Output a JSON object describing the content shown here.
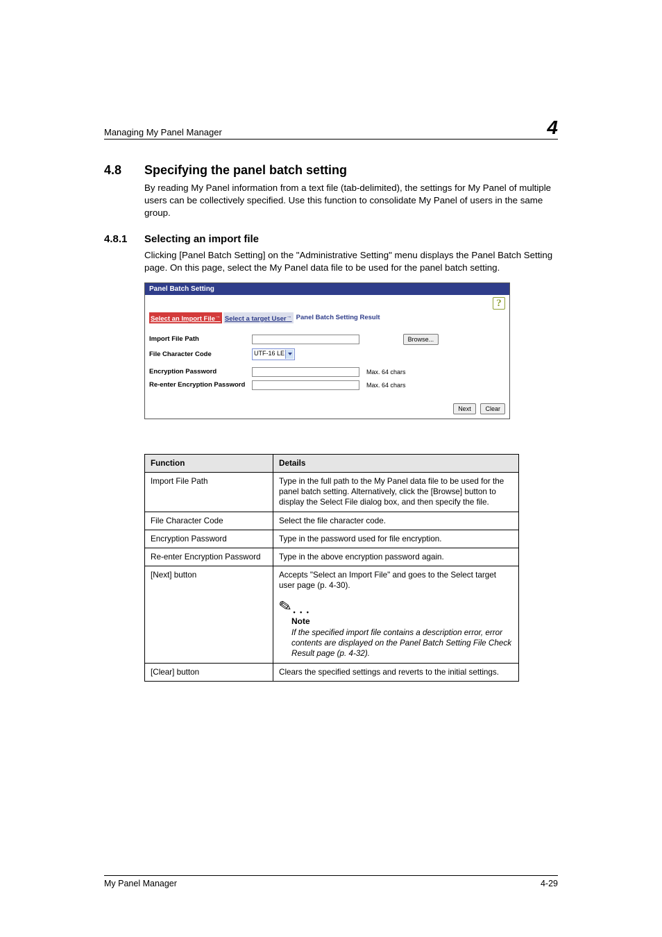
{
  "header": {
    "left": "Managing My Panel Manager",
    "right": "4"
  },
  "section": {
    "number": "4.8",
    "title": "Specifying the panel batch setting",
    "intro": "By reading My Panel information from a text file (tab-delimited), the settings for My Panel of multiple users can be collectively specified. Use this function to consolidate My Panel of users in the same group."
  },
  "subsection": {
    "number": "4.8.1",
    "title": "Selecting an import file",
    "intro": "Clicking [Panel Batch Setting] on the \"Administrative Setting\" menu displays the Panel Batch Setting page. On this page, select the My Panel data file to be used for the panel batch setting."
  },
  "panel": {
    "title": "Panel Batch Setting",
    "help_glyph": "?",
    "steps": {
      "s1": "Select an Import File",
      "s2": "Select a target User",
      "s3": "Panel Batch Setting Result"
    },
    "labels": {
      "import_path": "Import File Path",
      "file_char_code": "File Character Code",
      "enc_pw": "Encryption Password",
      "re_enc_pw": "Re-enter Encryption Password"
    },
    "select_value": "UTF-16 LE",
    "hint_max": "Max. 64 chars",
    "browse": "Browse...",
    "next": "Next",
    "clear": "Clear"
  },
  "table": {
    "head1": "Function",
    "head2": "Details",
    "rows": [
      {
        "f": "Import File Path",
        "d": "Type in the full path to the My Panel data file to be used for the panel batch setting. Alternatively, click the [Browse] button to display the Select File dialog box, and then specify the file."
      },
      {
        "f": "File Character Code",
        "d": "Select the file character code."
      },
      {
        "f": "Encryption Password",
        "d": "Type in the password used for file encryption."
      },
      {
        "f": "Re-enter Encryption Password",
        "d": "Type in the above encryption password again."
      },
      {
        "f": "[Next] button",
        "d": "Accepts \"Select an Import File\" and goes to the Select target user page (p. 4-30).",
        "note_title": "Note",
        "note_body": "If the specified import file contains a description error, error contents are displayed on the Panel Batch Setting File Check Result page (p. 4-32)."
      },
      {
        "f": "[Clear] button",
        "d": "Clears the specified settings and reverts to the initial settings."
      }
    ]
  },
  "footer": {
    "left": "My Panel Manager",
    "right": "4-29"
  }
}
